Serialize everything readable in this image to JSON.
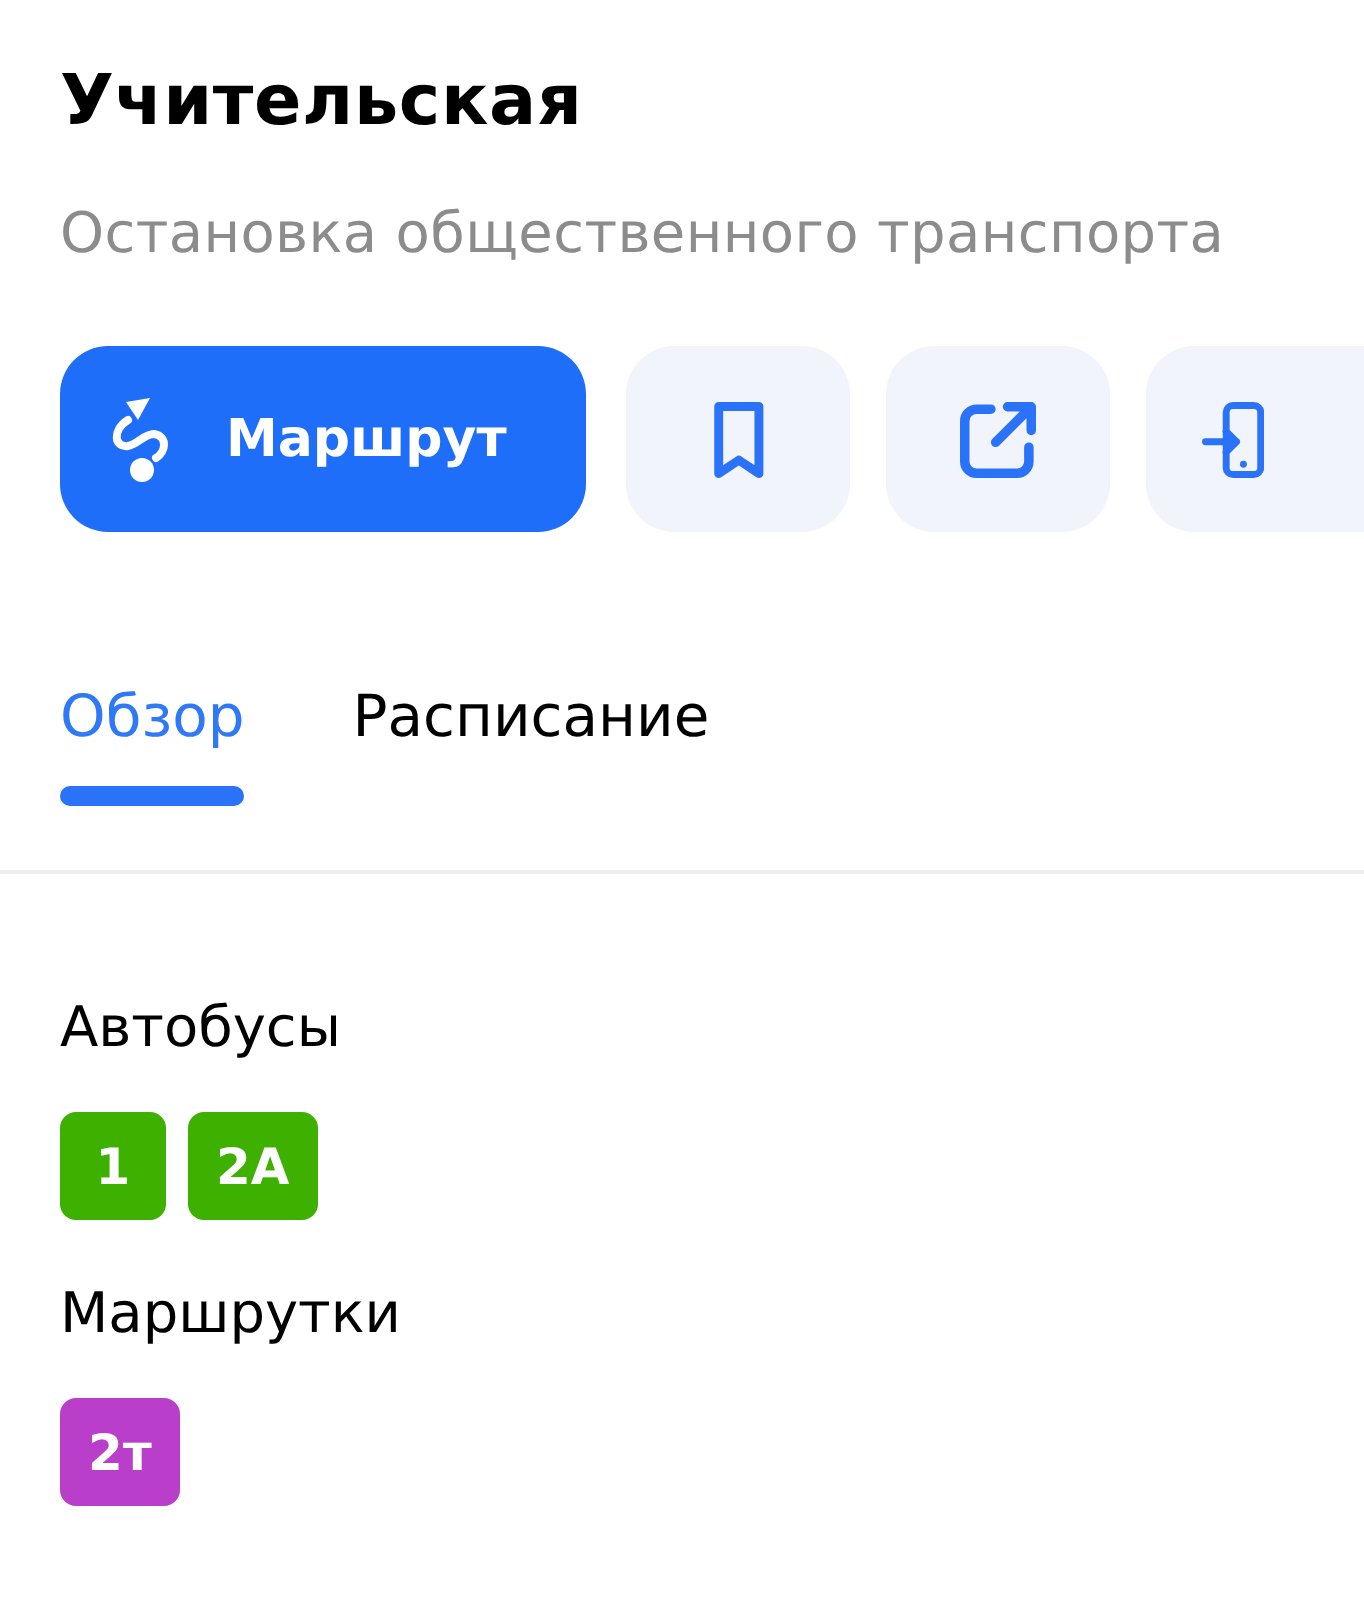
{
  "place": {
    "title": "Учительская",
    "subtitle": "Остановка общественного транспорта"
  },
  "route_button": {
    "label": "Маршрут"
  },
  "tabs": [
    {
      "label": "Обзор",
      "selected": true
    },
    {
      "label": "Расписание",
      "selected": false
    }
  ],
  "transport_groups": [
    {
      "name": "Автобусы",
      "routes": [
        {
          "label": "1",
          "color": "#3db000"
        },
        {
          "label": "2А",
          "color": "#3db000"
        }
      ]
    },
    {
      "name": "Маршрутки",
      "routes": [
        {
          "label": "2т",
          "color": "#b93fcb"
        }
      ]
    }
  ]
}
